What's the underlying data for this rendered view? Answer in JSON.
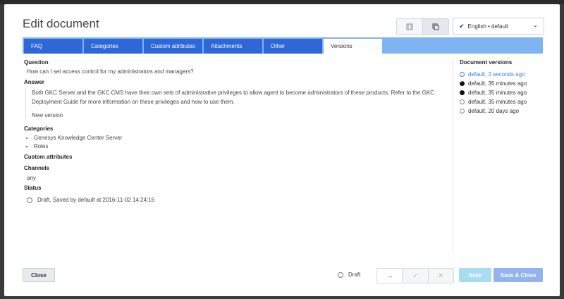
{
  "dialog": {
    "title": "Edit document",
    "language_selector": "English • default"
  },
  "tabs": [
    {
      "label": "FAQ"
    },
    {
      "label": "Categories"
    },
    {
      "label": "Custom attributes"
    },
    {
      "label": "Attachments"
    },
    {
      "label": "Other"
    },
    {
      "label": "Versions"
    }
  ],
  "content": {
    "question_label": "Question",
    "question_text": "How can I set access control for my administrators and managers?",
    "answer_label": "Answer",
    "answer_text": "Both GKC Server and the GKC CMS have their own sets of administrative privileges to allow agent to become administrators of these products. Refer to the GKC Deployment Guide for more information on these privileges and how to use them.",
    "answer_note": "New version",
    "categories_label": "Categories",
    "categories": [
      "Genesys Knowledge Center Server",
      "Roles"
    ],
    "custom_attributes_label": "Custom attributes",
    "channels_label": "Channels",
    "channels_value": "any",
    "status_label": "Status",
    "status_value": "Draft, Saved by default at 2016-11-02 14:24:16"
  },
  "versions": {
    "heading": "Document versions",
    "items": [
      {
        "label": "default, 2 seconds ago",
        "state": "current"
      },
      {
        "label": "default, 35 minutes ago",
        "state": "checked"
      },
      {
        "label": "default, 35 minutes ago",
        "state": "filled"
      },
      {
        "label": "default, 35 minutes ago",
        "state": "empty"
      },
      {
        "label": "default, 20 days ago",
        "state": "empty"
      }
    ]
  },
  "footer": {
    "close_label": "Close",
    "draft_label": "Draft",
    "next_icon": "→",
    "approve_icon": "✓",
    "reject_icon": "✕",
    "save_label": "Save",
    "save_close_label": "Save & Close"
  }
}
